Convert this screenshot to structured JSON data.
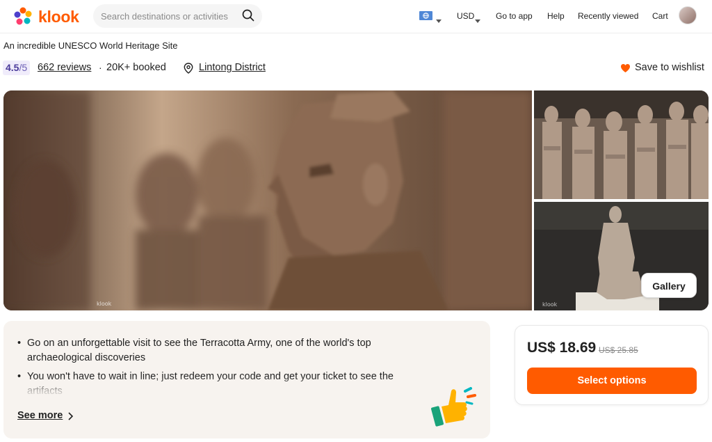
{
  "header": {
    "brand": "klook",
    "search_placeholder": "Search destinations or activities",
    "currency": "USD",
    "go_to_app": "Go to app",
    "help": "Help",
    "recently_viewed": "Recently viewed",
    "cart": "Cart"
  },
  "activity": {
    "subtitle": "An incredible UNESCO World Heritage Site",
    "rating_score": "4.5",
    "rating_outof": "/5",
    "reviews": "662 reviews",
    "separator": "·",
    "booked": "20K+ booked",
    "location": "Lintong District",
    "wishlist": "Save to wishlist"
  },
  "gallery": {
    "watermark": "klook",
    "button": "Gallery"
  },
  "highlights": {
    "items": [
      "Go on an unforgettable visit to see the Terracotta Army, one of the world's top archaeological discoveries",
      "You won't have to wait in line; just redeem your code and get your ticket to see the artifacts"
    ],
    "see_more": "See more"
  },
  "pricing": {
    "price": "US$ 18.69",
    "original_price": "US$ 25.85",
    "cta": "Select options"
  },
  "colors": {
    "brand_orange": "#ff5b00",
    "rating_bg": "#f0ecfb",
    "highlights_bg": "#f7f3ef"
  }
}
